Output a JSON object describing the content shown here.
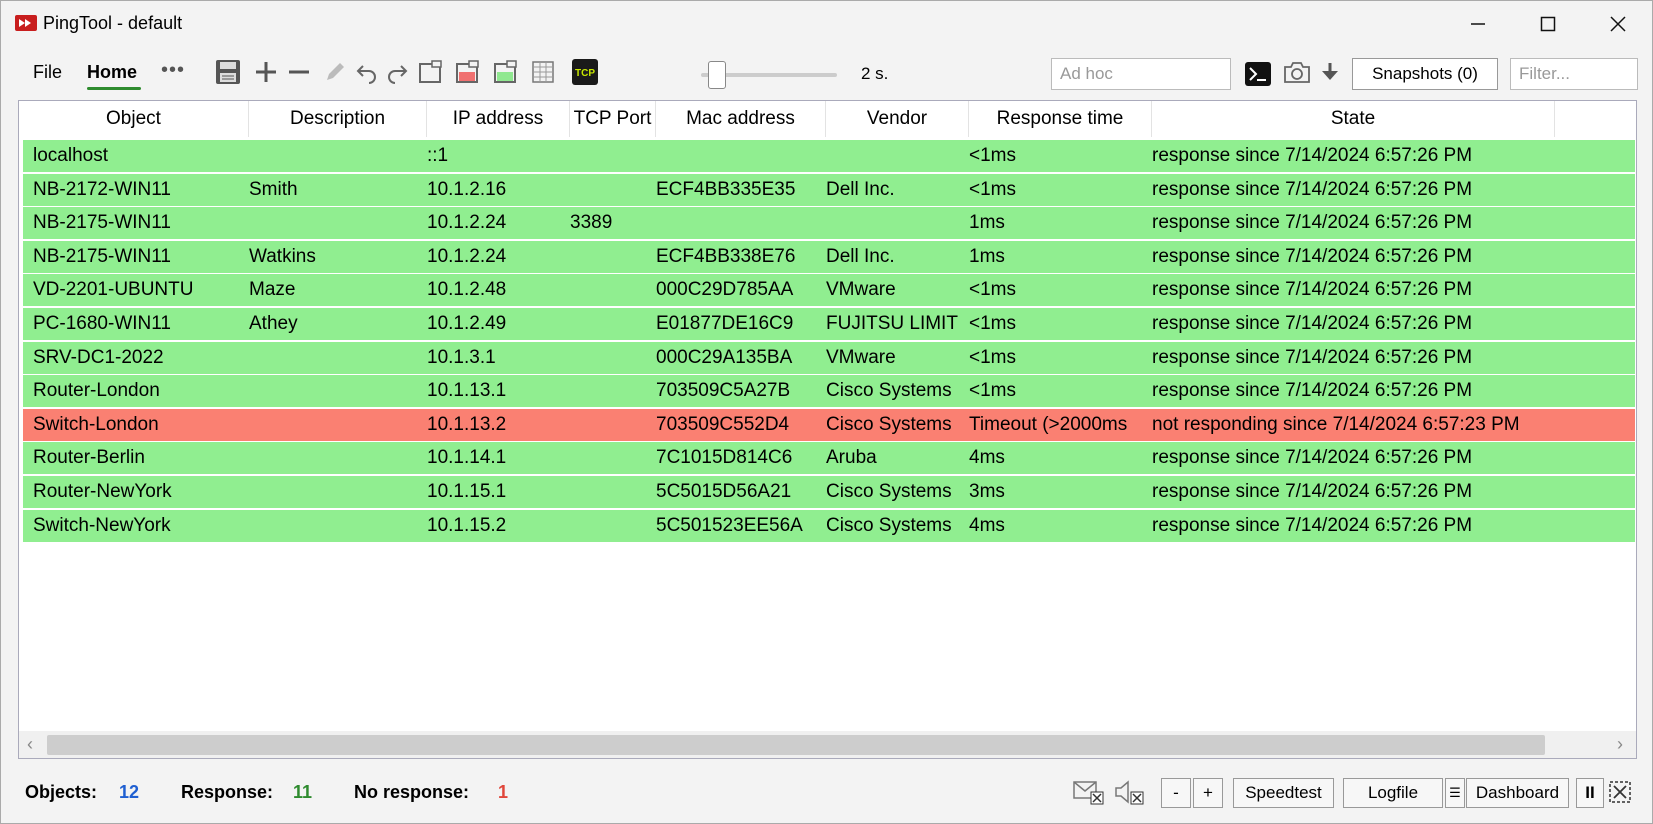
{
  "window": {
    "title": "PingTool - default",
    "min_glyph": "—",
    "max_glyph": "☐",
    "close_glyph": "✕"
  },
  "menu": {
    "file": "File",
    "home": "Home",
    "more": "•••"
  },
  "toolbar": {
    "icons": [
      "save-icon",
      "add-icon",
      "remove-icon",
      "edit-icon",
      "undo-icon",
      "redo-icon",
      "window-icon",
      "red-window-icon",
      "green-window-icon",
      "grid-icon",
      "tcp-icon"
    ],
    "tcp_label": "TCP",
    "interval_label": "2 s.",
    "interval_fraction": 0.1,
    "adhoc_placeholder": "Ad hoc",
    "snapshots_label": "Snapshots (0)",
    "filter_placeholder": "Filter..."
  },
  "colors": {
    "ok_row": "#90ee90",
    "fail_row": "#fa8072",
    "accent_green": "#2e8b2e",
    "objects_count": "#1f5fd1",
    "response_count": "#2e8b2e",
    "no_response_count": "#e0463a"
  },
  "table": {
    "columns": [
      "Object",
      "Description",
      "IP address",
      "TCP Port",
      "Mac address",
      "Vendor",
      "Response time",
      "State"
    ],
    "rows": [
      {
        "status": "ok",
        "cells": [
          "localhost",
          "",
          "::1",
          "",
          "",
          "",
          "<1ms",
          "response since 7/14/2024 6:57:26 PM"
        ]
      },
      {
        "status": "ok",
        "cells": [
          "NB-2172-WIN11",
          "Smith",
          "10.1.2.16",
          "",
          "ECF4BB335E35",
          "Dell Inc.",
          "<1ms",
          "response since 7/14/2024 6:57:26 PM"
        ]
      },
      {
        "status": "ok",
        "cells": [
          "NB-2175-WIN11",
          "",
          "10.1.2.24",
          "3389",
          "",
          "",
          "1ms",
          "response since 7/14/2024 6:57:26 PM"
        ]
      },
      {
        "status": "ok",
        "cells": [
          "NB-2175-WIN11",
          "Watkins",
          "10.1.2.24",
          "",
          "ECF4BB338E76",
          "Dell Inc.",
          "1ms",
          "response since 7/14/2024 6:57:26 PM"
        ]
      },
      {
        "status": "ok",
        "cells": [
          "VD-2201-UBUNTU",
          "Maze",
          "10.1.2.48",
          "",
          "000C29D785AA",
          "VMware",
          "<1ms",
          "response since 7/14/2024 6:57:26 PM"
        ]
      },
      {
        "status": "ok",
        "cells": [
          "PC-1680-WIN11",
          "Athey",
          "10.1.2.49",
          "",
          "E01877DE16C9",
          "FUJITSU LIMIT",
          "<1ms",
          "response since 7/14/2024 6:57:26 PM"
        ]
      },
      {
        "status": "ok",
        "cells": [
          "SRV-DC1-2022",
          "",
          "10.1.3.1",
          "",
          "000C29A135BA",
          "VMware",
          "<1ms",
          "response since 7/14/2024 6:57:26 PM"
        ]
      },
      {
        "status": "ok",
        "cells": [
          "Router-London",
          "",
          "10.1.13.1",
          "",
          "703509C5A27B",
          "Cisco Systems",
          "<1ms",
          "response since 7/14/2024 6:57:26 PM"
        ]
      },
      {
        "status": "fail",
        "cells": [
          "Switch-London",
          "",
          "10.1.13.2",
          "",
          "703509C552D4",
          "Cisco Systems",
          "Timeout (>2000ms",
          "not responding since 7/14/2024 6:57:23 PM"
        ]
      },
      {
        "status": "ok",
        "cells": [
          "Router-Berlin",
          "",
          "10.1.14.1",
          "",
          "7C1015D814C6",
          "Aruba",
          "4ms",
          "response since 7/14/2024 6:57:26 PM"
        ]
      },
      {
        "status": "ok",
        "cells": [
          "Router-NewYork",
          "",
          "10.1.15.1",
          "",
          "5C5015D56A21",
          "Cisco Systems",
          "3ms",
          "response since 7/14/2024 6:57:26 PM"
        ]
      },
      {
        "status": "ok",
        "cells": [
          "Switch-NewYork",
          "",
          "10.1.15.2",
          "",
          "5C501523EE56A",
          "Cisco Systems",
          "4ms",
          "response since 7/14/2024 6:57:26 PM"
        ]
      }
    ]
  },
  "scrollbar": {
    "left": "‹",
    "right": "›"
  },
  "status": {
    "objects_label": "Objects:",
    "objects_value": "12",
    "response_label": "Response:",
    "response_value": "11",
    "no_response_label": "No response:",
    "no_response_value": "1"
  },
  "statusbar_buttons": {
    "minus": "-",
    "plus": "+",
    "speedtest": "Speedtest",
    "logfile": "Logfile",
    "logfile_menu": "☰",
    "dashboard": "Dashboard",
    "pause": "II"
  }
}
